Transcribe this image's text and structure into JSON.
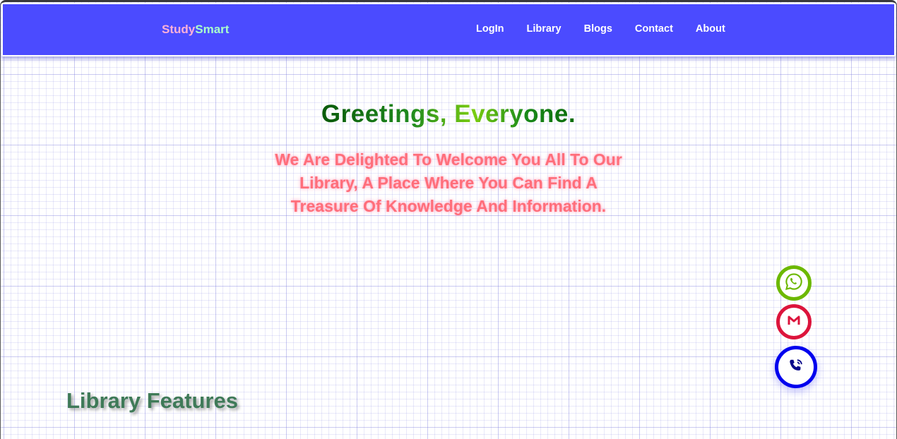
{
  "navbar": {
    "brand_part1": "Study",
    "brand_part2": "Smart",
    "links": [
      "LogIn",
      "Library",
      "Blogs",
      "Contact",
      "About"
    ]
  },
  "hero": {
    "greeting": "Greetings, Everyone.",
    "welcome": "We Are Delighted To Welcome You All To Our Library, A Place Where You Can Find A Treasure Of Knowledge And Information."
  },
  "features": {
    "title": "Library Features"
  },
  "floating_buttons": [
    {
      "icon": "whatsapp-icon",
      "color": "#6cb800"
    },
    {
      "icon": "gmail-icon",
      "color": "#dc143c"
    },
    {
      "icon": "phone-call-icon",
      "color": "#0000ee"
    }
  ],
  "colors": {
    "navbar_bg": "#4b4bff",
    "brand_study": "#ffb0d8",
    "brand_smart": "#a8ffcc",
    "greeting_green": "#117711",
    "welcome_pink": "#ff6e7a",
    "features_green": "#3f7a58"
  }
}
